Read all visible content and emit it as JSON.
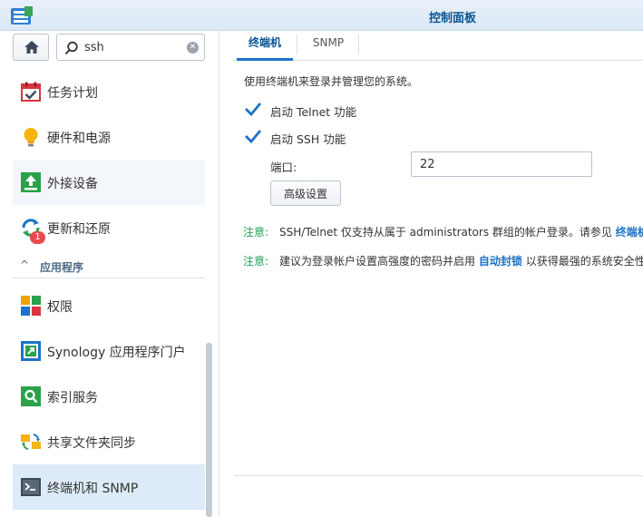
{
  "window": {
    "title": "控制面板"
  },
  "search": {
    "value": "ssh",
    "clear_symbol": "✕"
  },
  "sidebar": {
    "items": [
      {
        "label": "任务计划",
        "icon": "calendar-check-icon"
      },
      {
        "label": "硬件和电源",
        "icon": "lightbulb-icon"
      },
      {
        "label": "外接设备",
        "icon": "external-device-icon"
      },
      {
        "label": "更新和还原",
        "icon": "update-restore-icon",
        "badge": "1"
      },
      {
        "label": "权限",
        "icon": "permission-tiles-icon"
      },
      {
        "label": "Synology 应用程序门户",
        "icon": "app-portal-icon"
      },
      {
        "label": "索引服务",
        "icon": "index-search-icon"
      },
      {
        "label": "共享文件夹同步",
        "icon": "folder-sync-icon"
      },
      {
        "label": "终端机和 SNMP",
        "icon": "terminal-icon",
        "selected": true
      }
    ],
    "group": {
      "label": "应用程序",
      "chevron": "^"
    }
  },
  "tabs": [
    {
      "label": "终端机",
      "active": true
    },
    {
      "label": "SNMP",
      "active": false
    }
  ],
  "terminal": {
    "description": "使用终端机来登录并管理您的系统。",
    "telnet_label": "启动 Telnet 功能",
    "telnet_checked": true,
    "ssh_label": "启动 SSH 功能",
    "ssh_checked": true,
    "port_label": "端口:",
    "port_value": "22",
    "advanced_button": "高级设置"
  },
  "notes": [
    {
      "tag": "注意:",
      "text": "SSH/Telnet 仅支持从属于 administrators 群组的帐户登录。请参见 ",
      "link": "终端机"
    },
    {
      "tag": "注意:",
      "text": "建议为登录帐户设置高强度的密码并启用 ",
      "link": "自动封锁",
      "text_after": " 以获得最强的系统安全性"
    }
  ],
  "colors": {
    "accent": "#1c73c7",
    "note_green": "#22a15a",
    "selected_bg": "#ddebf8",
    "badge_red": "#e8494f"
  }
}
